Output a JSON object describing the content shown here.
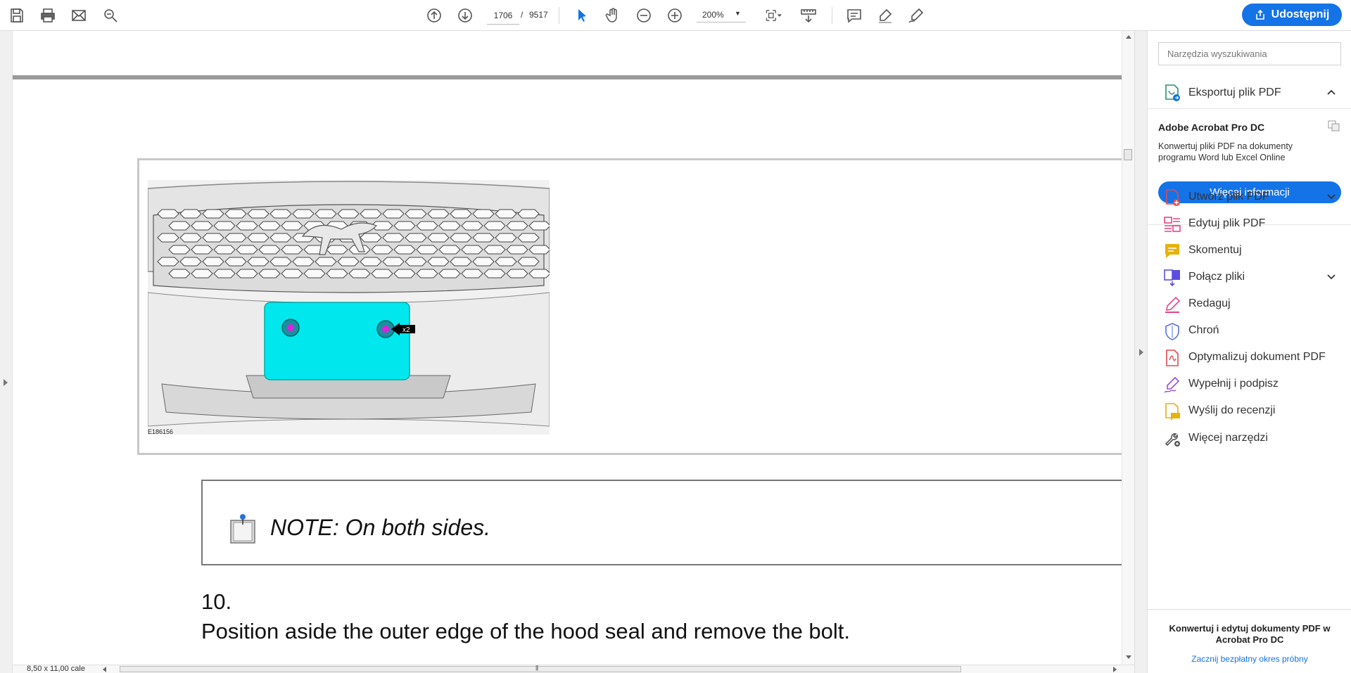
{
  "toolbar": {
    "page_current": "1706",
    "page_separator": "/",
    "page_total": "9517",
    "zoom": "200%",
    "share_label": "Udostępnij",
    "icons": [
      "save-icon",
      "print-icon",
      "mail-icon",
      "search-zoom-icon",
      "page-up-icon",
      "page-down-icon",
      "select-cursor-icon",
      "hand-icon",
      "zoom-out-icon",
      "zoom-in-icon",
      "fit-page-icon",
      "scroll-mode-icon",
      "comment-icon",
      "highlight-icon",
      "sign-icon",
      "share-icon"
    ],
    "accent": "#1473e6"
  },
  "document": {
    "figure_code": "E186156",
    "figure_callout": "x2",
    "note": "NOTE: On both sides.",
    "step_number": "10.",
    "step_text": "Position aside the outer edge of the hood seal and remove the bolt."
  },
  "status": {
    "page_size": "8,50 x 11,00 cale"
  },
  "right_panel": {
    "search_placeholder": "Narzędzia wyszukiwania",
    "export_label": "Eksportuj plik PDF",
    "promo": {
      "title": "Adobe Acrobat Pro DC",
      "description": "Konwertuj pliki PDF na dokumenty programu Word lub Excel Online",
      "button": "Więcej informacji"
    },
    "tools": [
      {
        "label": "Utwórz plik PDF",
        "icon": "create-pdf-icon",
        "color": "#e34850",
        "expandable": true
      },
      {
        "label": "Edytuj plik PDF",
        "icon": "edit-pdf-icon",
        "color": "#e3458c",
        "expandable": false
      },
      {
        "label": "Skomentuj",
        "icon": "comment-tool-icon",
        "color": "#e8b10b",
        "expandable": false
      },
      {
        "label": "Połącz pliki",
        "icon": "combine-files-icon",
        "color": "#5a4fe0",
        "expandable": true
      },
      {
        "label": "Redaguj",
        "icon": "redact-icon",
        "color": "#e3458c",
        "expandable": false
      },
      {
        "label": "Chroń",
        "icon": "protect-icon",
        "color": "#5a6fe0",
        "expandable": false
      },
      {
        "label": "Optymalizuj dokument PDF",
        "icon": "optimize-pdf-icon",
        "color": "#e34850",
        "expandable": false
      },
      {
        "label": "Wypełnij i podpisz",
        "icon": "fill-sign-icon",
        "color": "#9a4fe0",
        "expandable": false
      },
      {
        "label": "Wyślij do recenzji",
        "icon": "send-review-icon",
        "color": "#e8b10b",
        "expandable": false
      },
      {
        "label": "Więcej narzędzi",
        "icon": "more-tools-icon",
        "color": "#555555",
        "expandable": false
      }
    ],
    "footer_text": "Konwertuj i edytuj dokumenty PDF w Acrobat Pro DC",
    "footer_link": "Zacznij bezpłatny okres próbny"
  }
}
